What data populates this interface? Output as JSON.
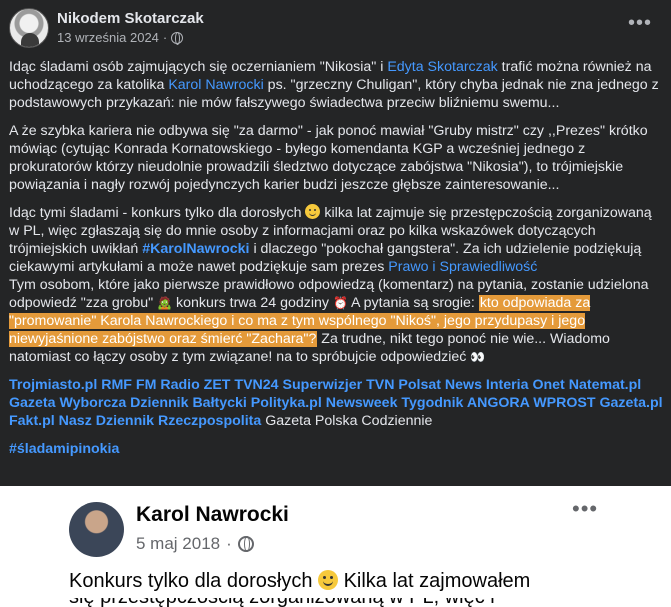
{
  "post": {
    "author": "Nikodem Skotarczak",
    "date": "13 września 2024",
    "separator": "·",
    "more": "•••",
    "p1": {
      "a": "Idąc śladami osób zajmujących się oczernianiem \"Nikosia\" i ",
      "link1": "Edyta Skotarczak",
      "b": " trafić można również na uchodzącego za katolika ",
      "link2": "Karol Nawrocki",
      "c": " ps. \"grzeczny Chuligan\", który chyba jednak nie zna jednego z podstawowych przykazań: nie mów fałszywego świadectwa przeciw bliźniemu swemu..."
    },
    "p2": "A że szybka kariera nie odbywa się \"za darmo\" - jak ponoć mawiał \"Gruby mistrz\" czy ,,Prezes\" krótko mówiąc (cytując Konrada Kornatowskiego - byłego komendanta KGP a wcześniej jednego z prokuratorów którzy nieudolnie prowadzili śledztwo dotyczące zabójstwa \"Nikosia\"), to trójmiejskie powiązania i nagły rozwój pojedynczych karier budzi jeszcze głębsze zainteresowanie...",
    "p3": {
      "a": "Idąc tymi śladami - konkurs tylko dla dorosłych ",
      "b": " kilka lat zajmuje się przestępczością zorganizowaną w PL, więc zgłaszają się do mnie osoby z informacjami oraz po kilka wskazówek dotyczących trójmiejskich uwikłań ",
      "hashtag1": "#KarolNawrocki",
      "c": " i dlaczego \"pokochał gangstera\". Za ich udzielenie podziękują ciekawymi artykułami a może nawet podziękuje sam prezes ",
      "link3": "Prawo i Sprawiedliwość",
      "d": "Tym osobom, które jako pierwsze prawidłowo odpowiedzą (komentarz) na pytania, zostanie udzielona odpowiedź \"zza grobu\" ",
      "e": " konkurs trwa 24 godziny ",
      "f": " A pytania są srogie: ",
      "highlight": "kto odpowiada za \"promowanie\" Karola Nawrockiego i co ma z tym wspólnego \"Nikoś\", jego przydupasy i jego niewyjaśnione zabójstwo oraz śmierć \"Zachara\"?",
      "g": "  Za trudne, nikt tego ponoć nie wie... Wiadomo natomiast co łączy osoby z tym związane! na to spróbujcie odpowiedzieć ",
      "eyes": "👀"
    },
    "tags": {
      "bold": "Trojmiasto.pl RMF FM Radio ZET TVN24 Superwizjer TVN Polsat News Interia Onet Natemat.pl Gazeta Wyborcza Dziennik Bałtycki Polityka.pl Newsweek Tygodnik ANGORA WPROST Gazeta.pl Fakt.pl Nasz Dziennik Rzeczpospolita",
      "plain": " Gazeta Polska Codziennie"
    },
    "hashtag2": "#śladamipinokia"
  },
  "embed": {
    "author": "Karol Nawrocki",
    "date": "5 maj 2018",
    "separator": "·",
    "more": "•••",
    "text_a": "Konkurs tylko dla dorosłych ",
    "text_b": " Kilka lat zajmowałem",
    "cut_text": "się przestępczością zorganizowaną w PL, więc i"
  },
  "colors": {
    "background": "#242526",
    "link": "#4599ff",
    "highlight": "#e49a3a"
  }
}
